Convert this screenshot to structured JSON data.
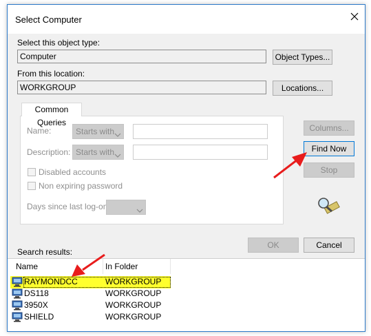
{
  "window": {
    "title": "Select Computer"
  },
  "object_type": {
    "label": "Select this object type:",
    "value": "Computer",
    "button": "Object Types..."
  },
  "location": {
    "label": "From this location:",
    "value": "WORKGROUP",
    "button": "Locations..."
  },
  "queries": {
    "tab": "Common Queries",
    "name_label": "Name:",
    "name_mode": "Starts with",
    "description_label": "Description:",
    "description_mode": "Starts with",
    "disabled_accounts": "Disabled accounts",
    "non_expiring": "Non expiring password",
    "days_label": "Days since last log-on:"
  },
  "side_buttons": {
    "columns": "Columns...",
    "find_now": "Find Now",
    "stop": "Stop"
  },
  "footer": {
    "ok": "OK",
    "cancel": "Cancel"
  },
  "results": {
    "label": "Search results:",
    "columns": {
      "name": "Name",
      "folder": "In Folder"
    },
    "rows": [
      {
        "name": "RAYMONDCC",
        "folder": "WORKGROUP"
      },
      {
        "name": "DS118",
        "folder": "WORKGROUP"
      },
      {
        "name": "3950X",
        "folder": "WORKGROUP"
      },
      {
        "name": "SHIELD",
        "folder": "WORKGROUP"
      }
    ]
  },
  "colors": {
    "accent": "#0078d7",
    "highlight": "#ffff2e",
    "arrow": "#e81c1c"
  },
  "icons": [
    "close-icon",
    "computer-icon",
    "find-people-icon",
    "chevron-down-icon"
  ]
}
